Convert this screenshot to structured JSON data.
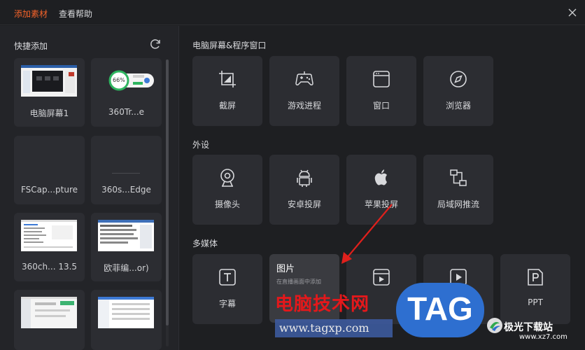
{
  "tabs": {
    "add_material": "添加素材",
    "help": "查看帮助"
  },
  "sidebar": {
    "title": "快捷添加",
    "items": [
      {
        "label": "电脑屏幕1"
      },
      {
        "label": "360Tr...e",
        "badge": "66%"
      },
      {
        "label": "FSCap...pture"
      },
      {
        "label": "360s...Edge"
      },
      {
        "label": "360ch... 13.5"
      },
      {
        "label": "欧菲编...or)"
      },
      {
        "label": ""
      },
      {
        "label": ""
      }
    ]
  },
  "sections": {
    "screen": {
      "title": "电脑屏幕&程序窗口",
      "items": [
        {
          "label": "截屏",
          "icon": "crop-icon"
        },
        {
          "label": "游戏进程",
          "icon": "gamepad-icon"
        },
        {
          "label": "窗口",
          "icon": "window-icon"
        },
        {
          "label": "浏览器",
          "icon": "compass-icon"
        }
      ]
    },
    "devices": {
      "title": "外设",
      "items": [
        {
          "label": "摄像头",
          "icon": "webcam-icon"
        },
        {
          "label": "安卓投屏",
          "icon": "android-icon"
        },
        {
          "label": "苹果投屏",
          "icon": "apple-icon"
        },
        {
          "label": "局域网推流",
          "icon": "network-icon"
        }
      ]
    },
    "media": {
      "title": "多媒体",
      "items": [
        {
          "label": "字幕",
          "icon": "text-icon"
        },
        {
          "label": "",
          "icon": "image-icon"
        },
        {
          "label": "",
          "icon": "video-icon"
        },
        {
          "label": "",
          "icon": "play-icon"
        },
        {
          "label": "PPT",
          "icon": "ppt-icon"
        }
      ]
    }
  },
  "tooltip": {
    "title": "图片",
    "desc": "在直播画面中添加"
  },
  "watermark": {
    "brand": "电脑技术网",
    "url": "www.tagxp.com",
    "tag": "TAG",
    "site": "极光下载站",
    "site_url": "www.xz7.com"
  },
  "colors": {
    "accent": "#f5632a",
    "background": "#1e1f22",
    "card": "#2c2d32",
    "arrow": "#e0201c"
  }
}
